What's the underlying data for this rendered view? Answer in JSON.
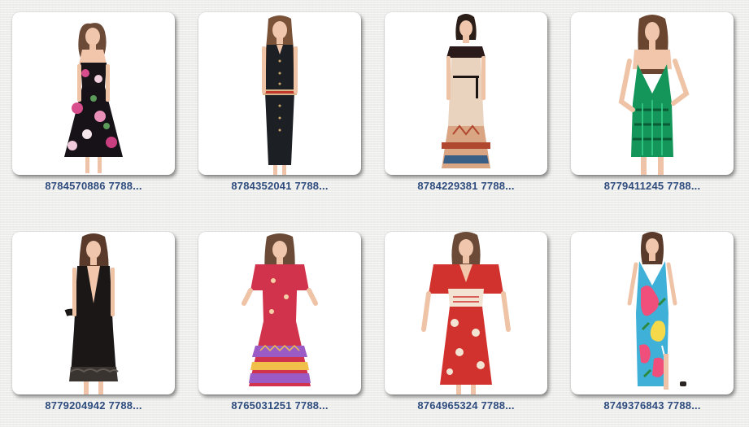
{
  "gallery": {
    "items": [
      {
        "caption": "8784570886 7788...",
        "image": "floral-strap-midi-dress",
        "dress_color": "#161218",
        "accent_color": "#d84d8c"
      },
      {
        "caption": "8784352041 7788...",
        "image": "black-denim-shirt-dress-with-belt",
        "dress_color": "#1c1f24",
        "accent_color": "#d7b78a"
      },
      {
        "caption": "8784229381 7788...",
        "image": "cold-shoulder-printed-maxi-dress",
        "dress_color": "#e9d3bf",
        "accent_color": "#b0482f"
      },
      {
        "caption": "8779411245 7788...",
        "image": "green-sequin-mini-dress",
        "dress_color": "#14965a",
        "accent_color": "#0b5a36"
      },
      {
        "caption": "8779204942 7788...",
        "image": "black-plunge-lace-hem-dress",
        "dress_color": "#1a1716",
        "accent_color": "#3a3431"
      },
      {
        "caption": "8765031251 7788...",
        "image": "red-boho-print-midi-dress",
        "dress_color": "#d2334c",
        "accent_color": "#9a5bc4"
      },
      {
        "caption": "8764965324 7788...",
        "image": "red-paisley-kaftan-dress",
        "dress_color": "#d2322e",
        "accent_color": "#f3e3d3"
      },
      {
        "caption": "8749376843 7788...",
        "image": "tropical-print-maxi-dress",
        "dress_color": "#3fb0d8",
        "accent_color": "#ef4f7a"
      }
    ]
  }
}
